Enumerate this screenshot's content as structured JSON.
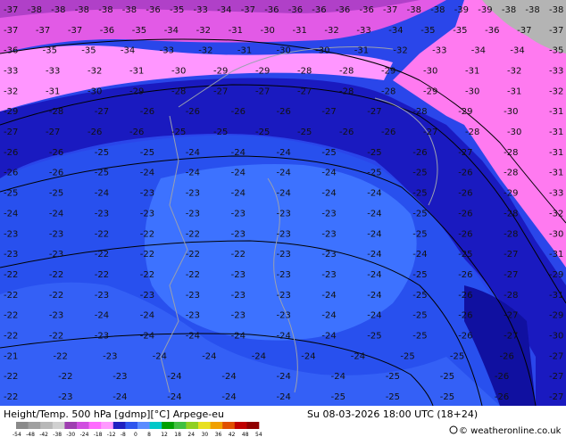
{
  "footer": {
    "title": "Height/Temp. 500 hPa [gdmp][°C] Arpege-eu",
    "datetime": "Su 08-03-2026 18:00 UTC (18+24)",
    "credit": "© weatheronline.co.uk"
  },
  "legend": {
    "ticks": [
      "-54",
      "-48",
      "-42",
      "-38",
      "-30",
      "-24",
      "-18",
      "-12",
      "-8",
      "0",
      "8",
      "12",
      "18",
      "24",
      "30",
      "36",
      "42",
      "48",
      "54"
    ],
    "colors": [
      "#8a8a8a",
      "#a0a0a0",
      "#b8b8b8",
      "#d0d0d0",
      "#9e3fb0",
      "#d04ee0",
      "#ff6cff",
      "#ff99ff",
      "#2020c0",
      "#2e55ee",
      "#5a8cff",
      "#00c8c8",
      "#00a000",
      "#40c040",
      "#90d020",
      "#e8e020",
      "#f0a000",
      "#e05000",
      "#c00000",
      "#900000"
    ]
  },
  "map": {
    "land_color": "#b4b4b4",
    "temp_labels": [
      {
        "row": [
          -37,
          -38,
          -38,
          -38,
          -38,
          -38,
          -36,
          -35,
          -33,
          -34,
          -37,
          -36,
          -36,
          -36,
          -36,
          -36,
          -37,
          -38,
          -38,
          -39,
          -39,
          -38,
          -38,
          -38
        ]
      },
      {
        "row": [
          -37,
          -37,
          -37,
          -36,
          -35,
          -34,
          -32,
          -31,
          -30,
          -31,
          -32,
          -33,
          -34,
          -35,
          -35,
          -36,
          -37,
          -37
        ]
      },
      {
        "row": [
          -36,
          -35,
          -35,
          -34,
          -33,
          -32,
          -31,
          -30,
          -30,
          -31,
          -32,
          -33,
          -34,
          -34,
          -35
        ]
      },
      {
        "row": [
          -33,
          -33,
          -32,
          -31,
          -30,
          -29,
          -29,
          -28,
          -28,
          -29,
          -30,
          -31,
          -32,
          -33
        ]
      },
      {
        "row": [
          -32,
          -31,
          -30,
          -29,
          -28,
          -27,
          -27,
          -27,
          -28,
          -28,
          -29,
          -30,
          -31,
          -32
        ]
      },
      {
        "row": [
          -29,
          -28,
          -27,
          -26,
          -26,
          -26,
          -26,
          -27,
          -27,
          -28,
          -29,
          -30,
          -31
        ]
      },
      {
        "row": [
          -27,
          -27,
          -26,
          -26,
          -25,
          -25,
          -25,
          -25,
          -26,
          -26,
          -27,
          -28,
          -30,
          -31
        ]
      },
      {
        "row": [
          -26,
          -26,
          -25,
          -25,
          -24,
          -24,
          -24,
          -25,
          -25,
          -26,
          -27,
          -28,
          -31
        ]
      },
      {
        "row": [
          -26,
          -26,
          -25,
          -24,
          -24,
          -24,
          -24,
          -24,
          -25,
          -25,
          -26,
          -28,
          -31
        ]
      },
      {
        "row": [
          -25,
          -25,
          -24,
          -23,
          -23,
          -24,
          -24,
          -24,
          -24,
          -25,
          -26,
          -29,
          -33
        ]
      },
      {
        "row": [
          -24,
          -24,
          -23,
          -23,
          -23,
          -23,
          -23,
          -23,
          -24,
          -25,
          -26,
          -28,
          -32
        ]
      },
      {
        "row": [
          -23,
          -23,
          -22,
          -22,
          -22,
          -23,
          -23,
          -23,
          -24,
          -25,
          -26,
          -28,
          -30
        ]
      },
      {
        "row": [
          -23,
          -23,
          -22,
          -22,
          -22,
          -22,
          -23,
          -23,
          -24,
          -24,
          -25,
          -27,
          -31
        ]
      },
      {
        "row": [
          -22,
          -22,
          -22,
          -22,
          -22,
          -23,
          -23,
          -23,
          -24,
          -25,
          -26,
          -27,
          -29
        ]
      },
      {
        "row": [
          -22,
          -22,
          -23,
          -23,
          -23,
          -23,
          -23,
          -24,
          -24,
          -25,
          -26,
          -28,
          -31
        ]
      },
      {
        "row": [
          -22,
          -23,
          -24,
          -24,
          -23,
          -23,
          -23,
          -24,
          -24,
          -25,
          -26,
          -27,
          -29
        ]
      },
      {
        "row": [
          -22,
          -22,
          -23,
          -24,
          -24,
          -24,
          -24,
          -24,
          -25,
          -25,
          -26,
          -27,
          -30
        ]
      },
      {
        "row": [
          -21,
          -22,
          -23,
          -24,
          -24,
          -24,
          -24,
          -24,
          -25,
          -25,
          -26,
          -27
        ]
      },
      {
        "row": [
          -22,
          -22,
          -23,
          -24,
          -24,
          -24,
          -24,
          -25,
          -25,
          -26,
          -27
        ]
      },
      {
        "row": [
          -22,
          -23,
          -24,
          -24,
          -24,
          -24,
          -25,
          -25,
          -25,
          -26,
          -27
        ]
      }
    ]
  }
}
